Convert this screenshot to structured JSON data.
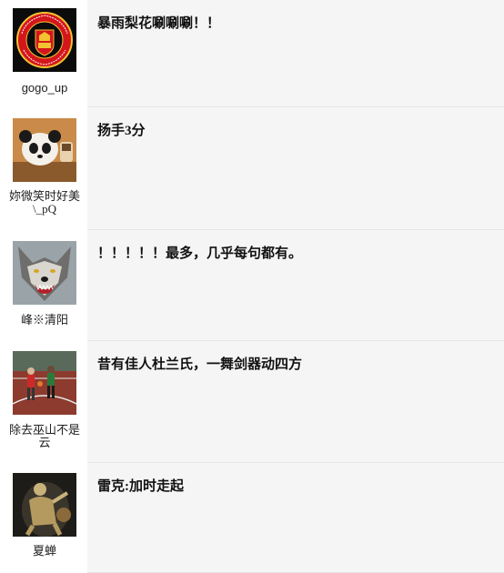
{
  "comments": [
    {
      "username": "gogo_up",
      "text": "暴雨梨花唰唰唰！！",
      "avatar_icon": "manchester-united-crest-avatar"
    },
    {
      "username": "妳微笑时好美\\_pQ",
      "text": "扬手3分",
      "avatar_icon": "panda-toy-avatar"
    },
    {
      "username": "峰※清阳",
      "text": "！！！！！最多，几乎每句都有。",
      "avatar_icon": "wolf-avatar"
    },
    {
      "username": "除去巫山不是云",
      "text": "昔有佳人杜兰氏，一舞剑器动四方",
      "avatar_icon": "basketball-court-avatar"
    },
    {
      "username": "夏蝉",
      "text": "雷克:加时走起",
      "avatar_icon": "basketball-player-avatar"
    }
  ]
}
